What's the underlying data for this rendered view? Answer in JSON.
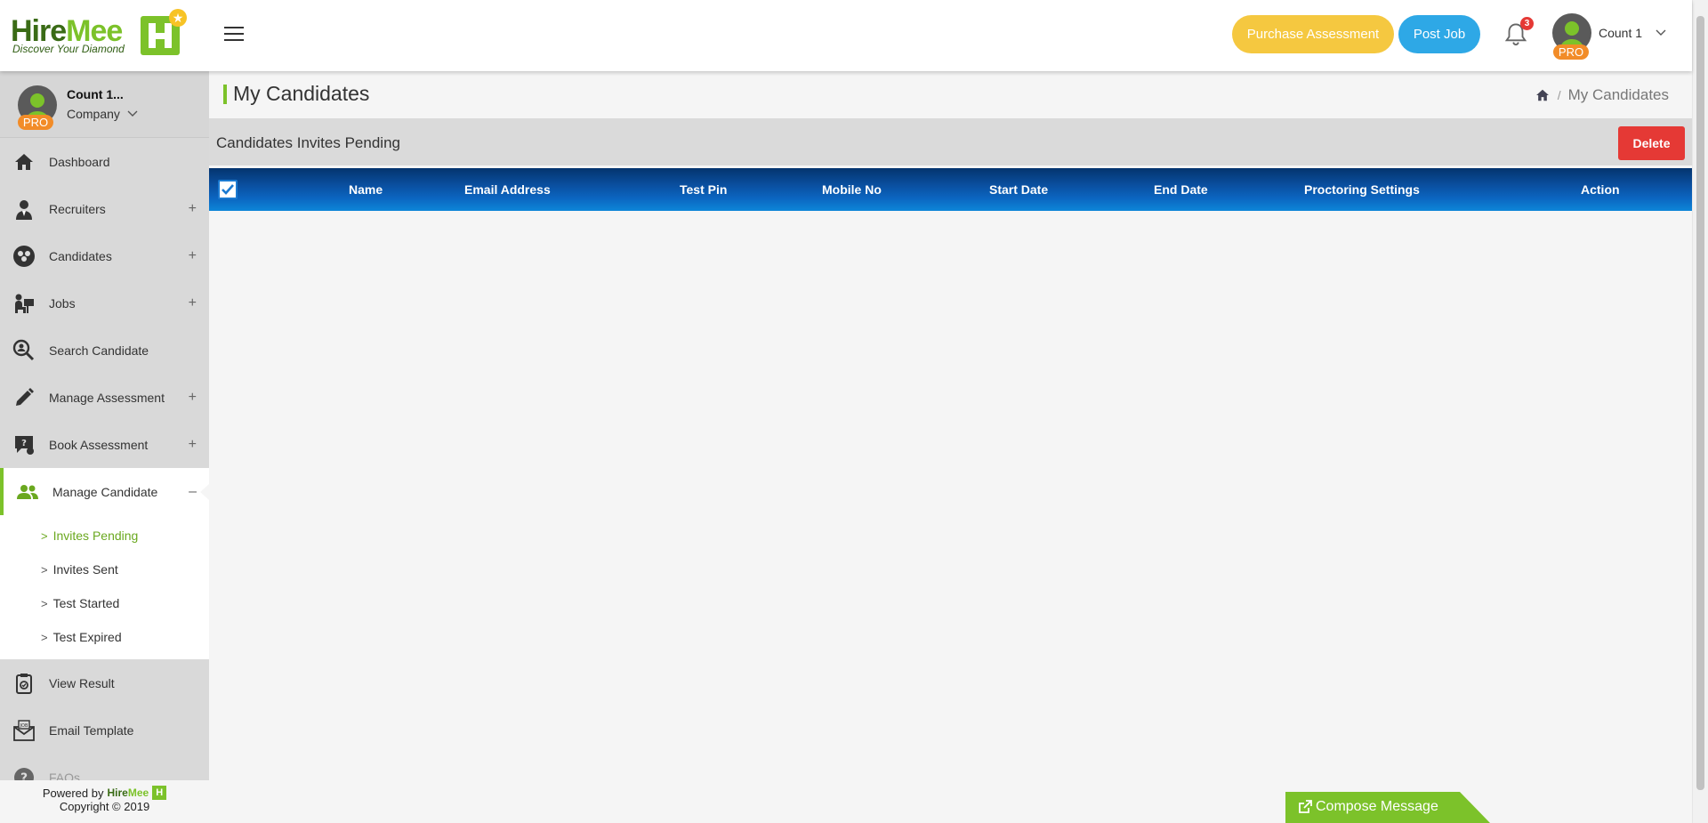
{
  "header": {
    "logo": {
      "hire": "Hire",
      "mee": "Mee",
      "tagline": "Discover Your Diamond"
    },
    "purchase_label": "Purchase Assessment",
    "post_job_label": "Post Job",
    "notification_count": "3",
    "user_name": "Count 1",
    "pro_label": "PRO"
  },
  "sidebar": {
    "profile_name": "Count 1...",
    "profile_role": "Company",
    "pro_label": "PRO",
    "items": [
      {
        "label": "Dashboard",
        "icon": "home-icon",
        "expandable": false
      },
      {
        "label": "Recruiters",
        "icon": "recruiter-icon",
        "expandable": true
      },
      {
        "label": "Candidates",
        "icon": "candidates-icon",
        "expandable": true
      },
      {
        "label": "Jobs",
        "icon": "jobs-icon",
        "expandable": true
      },
      {
        "label": "Search Candidate",
        "icon": "search-candidate-icon",
        "expandable": false
      },
      {
        "label": "Manage Assessment",
        "icon": "pencil-icon",
        "expandable": true
      },
      {
        "label": "Book Assessment",
        "icon": "book-assessment-icon",
        "expandable": true
      },
      {
        "label": "Manage Candidate",
        "icon": "users-icon",
        "expandable": true,
        "expanded": true
      },
      {
        "label": "View Result",
        "icon": "clipboard-icon",
        "expandable": false
      },
      {
        "label": "Email Template",
        "icon": "email-template-icon",
        "expandable": false
      },
      {
        "label": "FAQs",
        "icon": "question-icon",
        "expandable": false
      }
    ],
    "plus": "+",
    "minus": "–",
    "submenu": [
      "Invites Pending",
      "Invites Sent",
      "Test Started",
      "Test Expired"
    ],
    "footer": {
      "powered": "Powered by",
      "copyright": "Copyright © 2019"
    }
  },
  "main": {
    "page_title": "My Candidates",
    "breadcrumb": {
      "separator": "/",
      "current": "My Candidates"
    },
    "panel_title": "Candidates Invites Pending",
    "delete_label": "Delete",
    "columns": [
      "Name",
      "Email Address",
      "Test Pin",
      "Mobile No",
      "Start Date",
      "End Date",
      "Proctoring Settings",
      "Action"
    ],
    "rows": [],
    "compose_label": "Compose Message"
  },
  "colors": {
    "brand_green": "#7cc22a",
    "purchase": "#f5c840",
    "post": "#2ea8e6",
    "delete": "#e53935",
    "pro": "#f28c28",
    "table_head": "#0b65c0"
  }
}
